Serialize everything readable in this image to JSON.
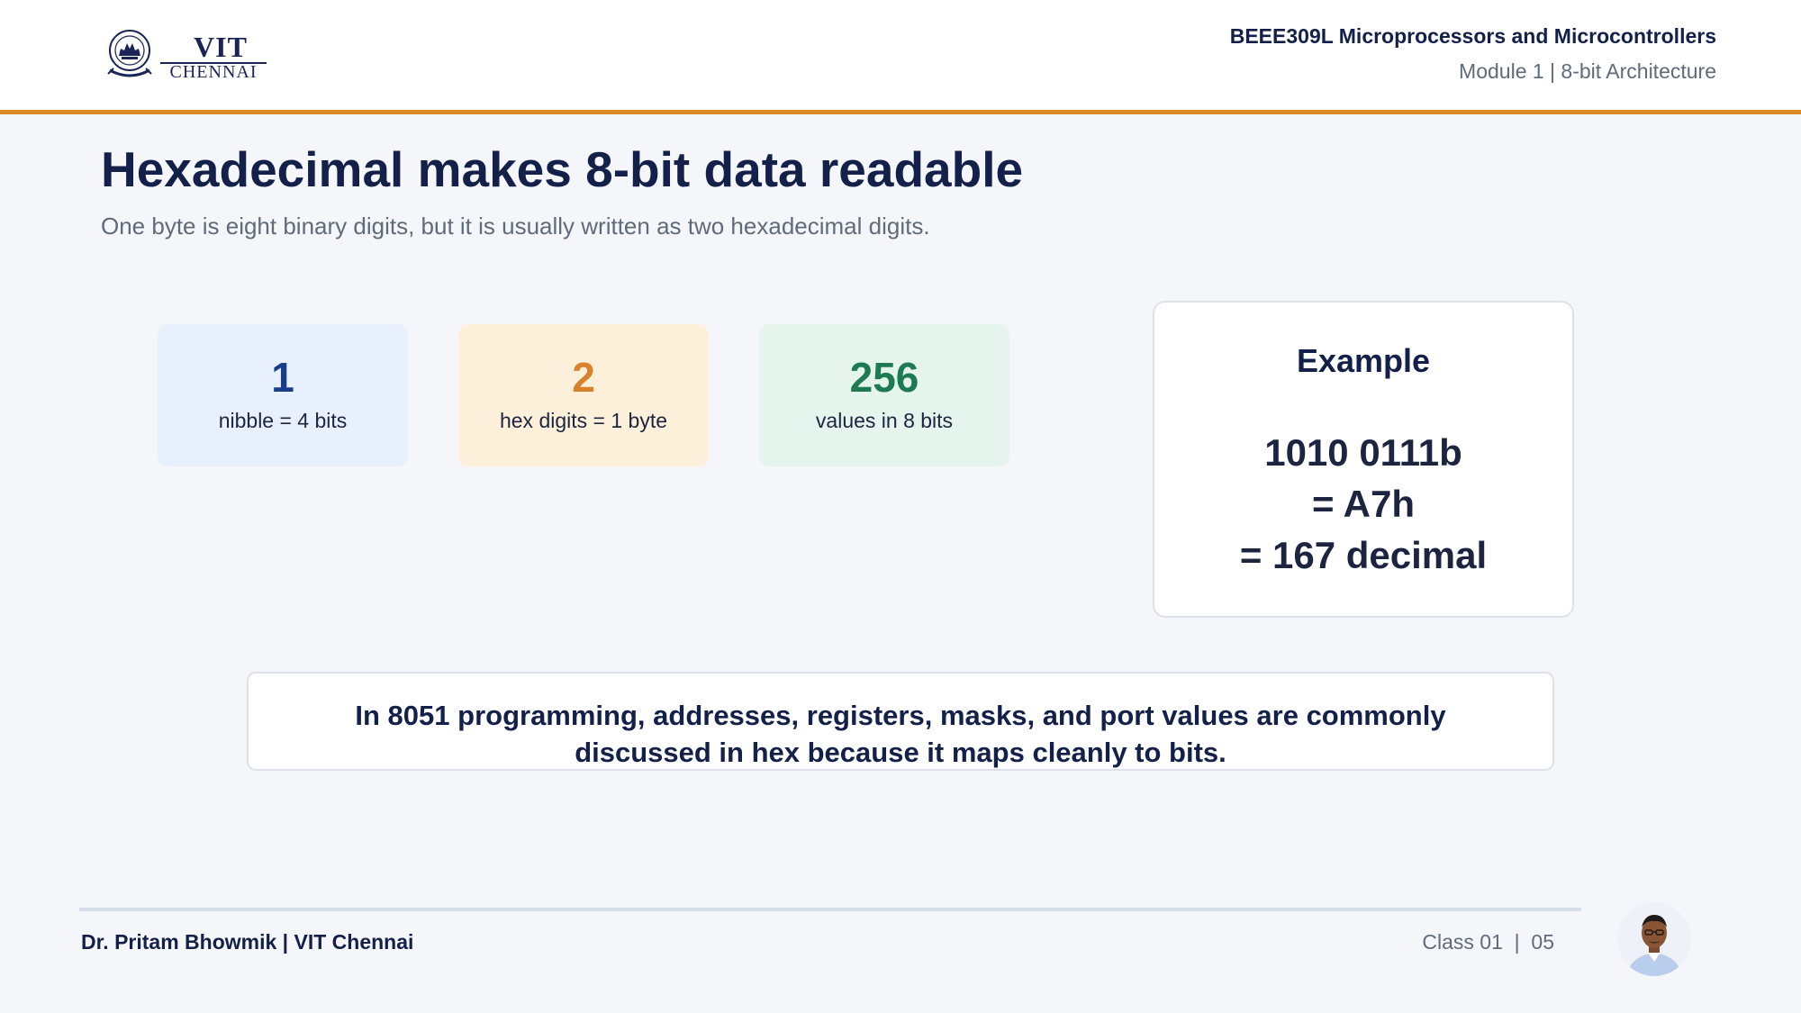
{
  "logo": {
    "text_main": "VIT",
    "text_sub": "CHENNAI"
  },
  "header": {
    "course": "BEEE309L Microprocessors and Microcontrollers",
    "module": "Module 1 | 8-bit Architecture"
  },
  "slide": {
    "title": "Hexadecimal makes 8-bit data readable",
    "subtitle": "One byte is eight binary digits, but it is usually written as two hexadecimal digits."
  },
  "stats": [
    {
      "value": "1",
      "label": "nibble = 4 bits",
      "color": "#1a3d8a",
      "background": "#e8f0fd"
    },
    {
      "value": "2",
      "label": "hex digits = 1 byte",
      "color": "#d9822b",
      "background": "#fdf0da"
    },
    {
      "value": "256",
      "label": "values in 8 bits",
      "color": "#1d7a52",
      "background": "#e5f4ec"
    }
  ],
  "example": {
    "title": "Example",
    "lines": [
      "1010 0111b",
      "= A7h",
      "= 167 decimal"
    ]
  },
  "note": {
    "text": "In 8051 programming, addresses, registers, masks, and port values are commonly discussed in hex because it maps cleanly to bits."
  },
  "footer": {
    "author": "Dr. Pritam Bhowmik | VIT Chennai",
    "class_label": "Class 01",
    "separator": "|",
    "page": "05"
  },
  "colors": {
    "accent": "#d98a26",
    "navy": "#13204a",
    "muted": "#5f6b7a"
  }
}
